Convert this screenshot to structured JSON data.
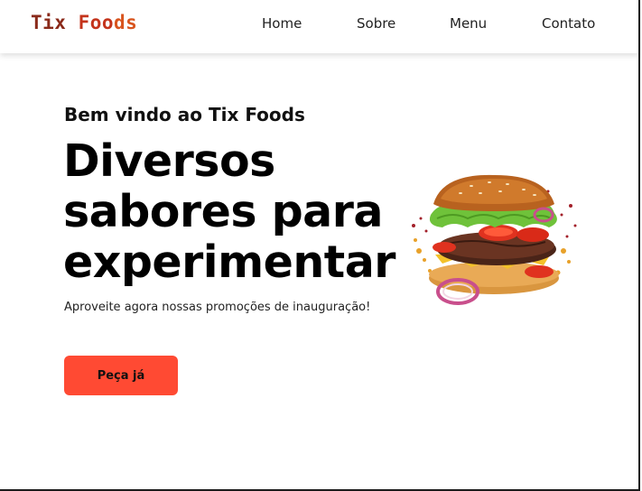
{
  "brand": {
    "part1": "Tix ",
    "part2": "Foo",
    "part3": "ds"
  },
  "nav": {
    "home": "Home",
    "about": "Sobre",
    "menu": "Menu",
    "contact": "Contato"
  },
  "hero": {
    "subtitle": "Bem vindo ao Tix Foods",
    "title_line1": "Diversos",
    "title_line2": "sabores para",
    "title_line3": "experimentar",
    "text": "Aproveite agora nossas promoções de inauguração!",
    "button": "Peça já"
  },
  "colors": {
    "accent": "#ff4a33",
    "brand_dark": "#8a2a1a",
    "brand_mid": "#c4341c"
  },
  "image": {
    "subject": "burger-illustration"
  }
}
